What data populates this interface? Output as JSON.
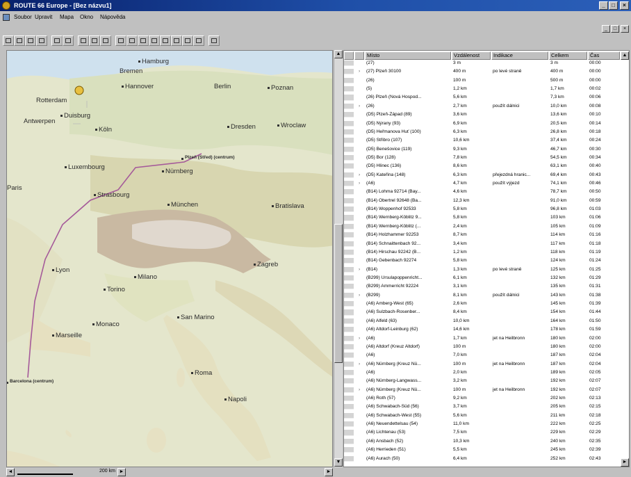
{
  "window": {
    "title": "ROUTE 66 Europe - [Bez názvu1]",
    "btn_min": "_",
    "btn_max": "□",
    "btn_close": "×"
  },
  "menu": {
    "items": [
      "Soubor",
      "Upravit",
      "Mapa",
      "Okno",
      "Nápověda"
    ]
  },
  "map": {
    "cities": [
      "Hamburg",
      "Bremen",
      "Hannover",
      "Berlin",
      "Poznan",
      "Rotterdam",
      "Duisburg",
      "Antwerpen",
      "Köln",
      "Dresden",
      "Wroclaw",
      "Luxembourg",
      "Nürnberg",
      "Plzeň (Střed) (centrum)",
      "Paris",
      "Strasbourg",
      "München",
      "Bratislava",
      "Lyon",
      "Milano",
      "Zagreb",
      "Torino",
      "San Marino",
      "Monaco",
      "Marseille",
      "Roma",
      "Napoli",
      "Barcelona (centrum)"
    ],
    "scale": "200 km"
  },
  "route_table": {
    "columns": [
      "Místo",
      "Vzdálenost",
      "Indikace",
      "Celkem",
      "Čas"
    ],
    "rows": [
      [
        "(27)",
        "3 m",
        "",
        "3 m",
        "00:00"
      ],
      [
        "(27) Plzeň 30100",
        "400 m",
        "po levé straně",
        "400 m",
        "00:00"
      ],
      [
        "(26)",
        "100 m",
        "",
        "500 m",
        "00:00"
      ],
      [
        "(5)",
        "1,2 km",
        "",
        "1,7 km",
        "00:02"
      ],
      [
        "(26) Plzeň (Nová Hospod...",
        "5,6 km",
        "",
        "7,3 km",
        "00:06"
      ],
      [
        "(26)",
        "2,7 km",
        "použít dálnici",
        "10,0 km",
        "00:08"
      ],
      [
        "(D5) Plzeň-Západ (89)",
        "3,6 km",
        "",
        "13,6 km",
        "00:10"
      ],
      [
        "(D5) Nýrany (93)",
        "6,9 km",
        "",
        "20,5 km",
        "00:14"
      ],
      [
        "(D5) Heřmanova Huť (100)",
        "6,3 km",
        "",
        "26,8 km",
        "00:18"
      ],
      [
        "(D5) Střibro (107)",
        "10,6 km",
        "",
        "37,4 km",
        "00:24"
      ],
      [
        "(D5) Benešovice (119)",
        "9,3 km",
        "",
        "46,7 km",
        "00:30"
      ],
      [
        "(D5) Bor (128)",
        "7,8 km",
        "",
        "54,5 km",
        "00:34"
      ],
      [
        "(D5) Hlinec (136)",
        "8,6 km",
        "",
        "63,1 km",
        "00:40"
      ],
      [
        "(D5) Kateřina (148)",
        "6,3 km",
        "přejezdná hranic...",
        "69,4 km",
        "00:43"
      ],
      [
        "(A6)",
        "4,7 km",
        "použít výjezd",
        "74,1 km",
        "00:46"
      ],
      [
        "(B14) Lohma 92714 (Bay...",
        "4,6 km",
        "",
        "78,7 km",
        "00:50"
      ],
      [
        "(B14) Obertrel 92648 (Ba...",
        "12,3 km",
        "",
        "91,0 km",
        "00:59"
      ],
      [
        "(B14) Woppenhof 92533",
        "5,8 km",
        "",
        "96,8 km",
        "01:03"
      ],
      [
        "(B14) Wernberg-Köblitz 9...",
        "5,8 km",
        "",
        "103 km",
        "01:06"
      ],
      [
        "(B14) Wernberg-Köblitz (...",
        "2,4 km",
        "",
        "105 km",
        "01:09"
      ],
      [
        "(B14) Holzhammer 92253",
        "8,7 km",
        "",
        "114 km",
        "01:16"
      ],
      [
        "(B14) Schnaittenbach 92...",
        "3,4 km",
        "",
        "117 km",
        "01:18"
      ],
      [
        "(B14) Hirschau 92242 (B...",
        "1,2 km",
        "",
        "118 km",
        "01:19"
      ],
      [
        "(B14) Gebenbach 92274",
        "5,8 km",
        "",
        "124 km",
        "01:24"
      ],
      [
        "(B14)",
        "1,3 km",
        "po levé straně",
        "125 km",
        "01:25"
      ],
      [
        "(B299) Ursulapoppenricht...",
        "6,1 km",
        "",
        "132 km",
        "01:29"
      ],
      [
        "(B299) Ammerricht 92224",
        "3,1 km",
        "",
        "135 km",
        "01:31"
      ],
      [
        "(B299)",
        "8,1 km",
        "použít dálnici",
        "143 km",
        "01:38"
      ],
      [
        "(A6) Amberg-West (65)",
        "2,6 km",
        "",
        "145 km",
        "01:39"
      ],
      [
        "(A6) Sulzbach-Rosenber...",
        "8,4 km",
        "",
        "154 km",
        "01:44"
      ],
      [
        "(A6) Alfeld (63)",
        "10,0 km",
        "",
        "164 km",
        "01:50"
      ],
      [
        "(A6) Altdorf-Leinburg (62)",
        "14,6 km",
        "",
        "178 km",
        "01:59"
      ],
      [
        "(A6)",
        "1,7 km",
        "jet na Heilbronn",
        "180 km",
        "02:00"
      ],
      [
        "(A6) Altdorf (Kreuz Altdorf)",
        "100 m",
        "",
        "180 km",
        "02:00"
      ],
      [
        "(A6)",
        "7,0 km",
        "",
        "187 km",
        "02:04"
      ],
      [
        "(A6) Nürnberg (Kreuz Nü...",
        "100 m",
        "jet na Heilbronn",
        "187 km",
        "02:04"
      ],
      [
        "(A6)",
        "2,0 km",
        "",
        "189 km",
        "02:05"
      ],
      [
        "(A6) Nürnberg-Langwass...",
        "3,2 km",
        "",
        "192 km",
        "02:07"
      ],
      [
        "(A6) Nürnberg (Kreuz Nü...",
        "100 m",
        "jet na Heilbronn",
        "192 km",
        "02:07"
      ],
      [
        "(A6) Roth (57)",
        "9,2 km",
        "",
        "202 km",
        "02:13"
      ],
      [
        "(A6) Schwabach-Süd (56)",
        "3,7 km",
        "",
        "205 km",
        "02:15"
      ],
      [
        "(A6) Schwabach-West (55)",
        "5,6 km",
        "",
        "211 km",
        "02:18"
      ],
      [
        "(A6) Neuendettelsau (54)",
        "11,0 km",
        "",
        "222 km",
        "02:25"
      ],
      [
        "(A6) Lichtenau (53)",
        "7,5 km",
        "",
        "229 km",
        "02:29"
      ],
      [
        "(A6) Ansbach (52)",
        "10,3 km",
        "",
        "240 km",
        "02:35"
      ],
      [
        "(A6) Herrieden (51)",
        "5,5 km",
        "",
        "245 km",
        "02:39"
      ],
      [
        "(A6) Aurach (50)",
        "6,4 km",
        "",
        "252 km",
        "02:43"
      ]
    ]
  }
}
